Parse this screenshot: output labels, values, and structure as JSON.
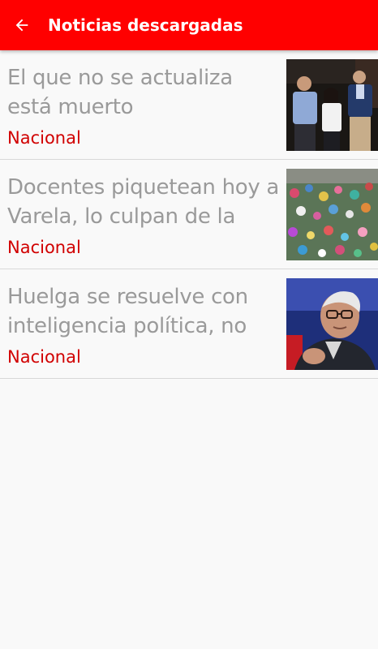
{
  "app_bar": {
    "title": "Noticias descargadas",
    "back_icon": "arrow-left-icon",
    "color": "#ff0000"
  },
  "articles": [
    {
      "title": "El que no se actualiza está muerto",
      "category": "Nacional",
      "thumbnail": "photo-three-politicians"
    },
    {
      "title": "Docentes piquetean hoy a Varela, lo culpan de la",
      "category": "Nacional",
      "thumbnail": "photo-protest-crowd"
    },
    {
      "title": "Huelga se resuelve con inteligencia política, no",
      "category": "Nacional",
      "thumbnail": "photo-man-glasses-interview"
    }
  ],
  "colors": {
    "title_text": "#9a9a9a",
    "category_text": "#d10000",
    "background": "#f9f9f9"
  }
}
